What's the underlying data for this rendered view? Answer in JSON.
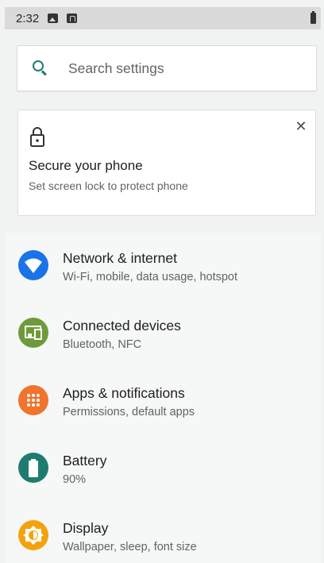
{
  "status_bar": {
    "time": "2:32"
  },
  "search": {
    "placeholder": "Search settings"
  },
  "suggestion": {
    "title": "Secure your phone",
    "summary": "Set screen lock to protect phone"
  },
  "settings": [
    {
      "title": "Network & internet",
      "summary": "Wi-Fi, mobile, data usage, hotspot",
      "icon": "wifi-icon",
      "color": "#1a73e8"
    },
    {
      "title": "Connected devices",
      "summary": "Bluetooth, NFC",
      "icon": "devices-icon",
      "color": "#6f9a3a"
    },
    {
      "title": "Apps & notifications",
      "summary": "Permissions, default apps",
      "icon": "apps-icon",
      "color": "#f2732b"
    },
    {
      "title": "Battery",
      "summary": "90%",
      "icon": "battery-icon",
      "color": "#1e7c6f"
    },
    {
      "title": "Display",
      "summary": "Wallpaper, sleep, font size",
      "icon": "brightness-icon",
      "color": "#f4a20c"
    }
  ]
}
